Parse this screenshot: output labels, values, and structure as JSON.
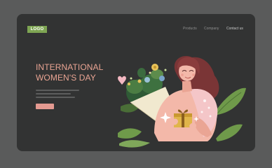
{
  "header": {
    "logo": "LOGO",
    "nav": [
      {
        "label": "Products"
      },
      {
        "label": "Company"
      },
      {
        "label": "Contact us"
      }
    ]
  },
  "hero": {
    "title_line1": "INTERNATIONAL",
    "title_line2": "WOMEN'S DAY",
    "button_label": ""
  },
  "colors": {
    "page_bg": "#5a5b5b",
    "card_bg": "#323333",
    "logo_bg": "#7ea553",
    "accent": "#e49a91"
  },
  "illustration": {
    "subject": "woman holding gift box with bouquet of flowers",
    "icons": [
      "woman-illustration",
      "gift-box-icon",
      "bouquet-icon",
      "leaf-icon",
      "heart-icon",
      "sparkle-icon"
    ]
  }
}
